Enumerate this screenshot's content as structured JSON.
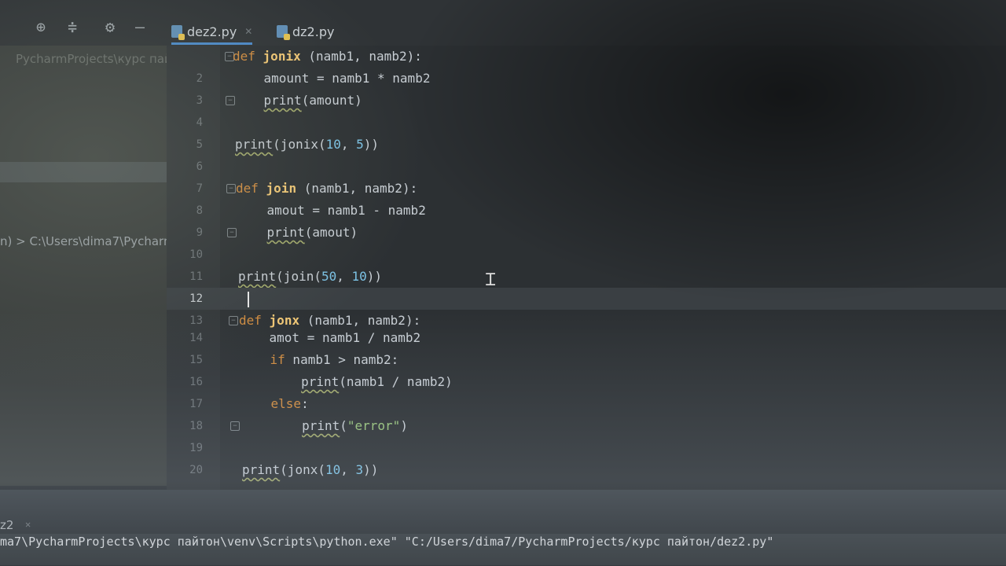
{
  "toolbar": {
    "icons": [
      "globe-icon",
      "collapse-icon",
      "gear-icon",
      "minimize-icon"
    ]
  },
  "tabs": [
    {
      "label": "dez2.py",
      "active": true,
      "icon": "python-file-icon"
    },
    {
      "label": "dz2.py",
      "active": false,
      "icon": "python-file-icon"
    }
  ],
  "sidebar": {
    "project_title": "PycharmProjects\\курс пай",
    "path_text": "n) > C:\\Users\\dima7\\Pycharm"
  },
  "editor": {
    "current_line": 12,
    "lines": [
      {
        "n": "",
        "text": "def jonix (namb1, namb2):"
      },
      {
        "n": "2",
        "text": "    amount = namb1 * namb2"
      },
      {
        "n": "3",
        "text": "    print(amount)"
      },
      {
        "n": "4",
        "text": ""
      },
      {
        "n": "5",
        "text": "print(jonix(10, 5))"
      },
      {
        "n": "6",
        "text": ""
      },
      {
        "n": "7",
        "text": "def join (namb1, namb2):"
      },
      {
        "n": "8",
        "text": "    amout = namb1 - namb2"
      },
      {
        "n": "9",
        "text": "    print(amout)"
      },
      {
        "n": "10",
        "text": ""
      },
      {
        "n": "11",
        "text": "print(join(50, 10))"
      },
      {
        "n": "12",
        "text": ""
      },
      {
        "n": "13",
        "text": "def jonx (namb1, namb2):"
      },
      {
        "n": "14",
        "text": "    amot = namb1 / namb2"
      },
      {
        "n": "15",
        "text": "    if namb1 > namb2:"
      },
      {
        "n": "16",
        "text": "        print(namb1 / namb2)"
      },
      {
        "n": "17",
        "text": "    else:"
      },
      {
        "n": "18",
        "text": "        print(\"error\")"
      },
      {
        "n": "19",
        "text": ""
      },
      {
        "n": "20",
        "text": "print(jonx(10, 3))"
      }
    ]
  },
  "run_panel": {
    "tab_label": "z2",
    "command": "ma7\\PycharmProjects\\курс пайтон\\venv\\Scripts\\python.exe\" \"C:/Users/dima7/PycharmProjects/курс пайтон/dez2.py\""
  },
  "colors": {
    "keyword": "#d08b3f",
    "function_name": "#f0c674",
    "number": "#7cc3e6",
    "string": "#97c37a",
    "editor_bg": "#2c3033"
  }
}
